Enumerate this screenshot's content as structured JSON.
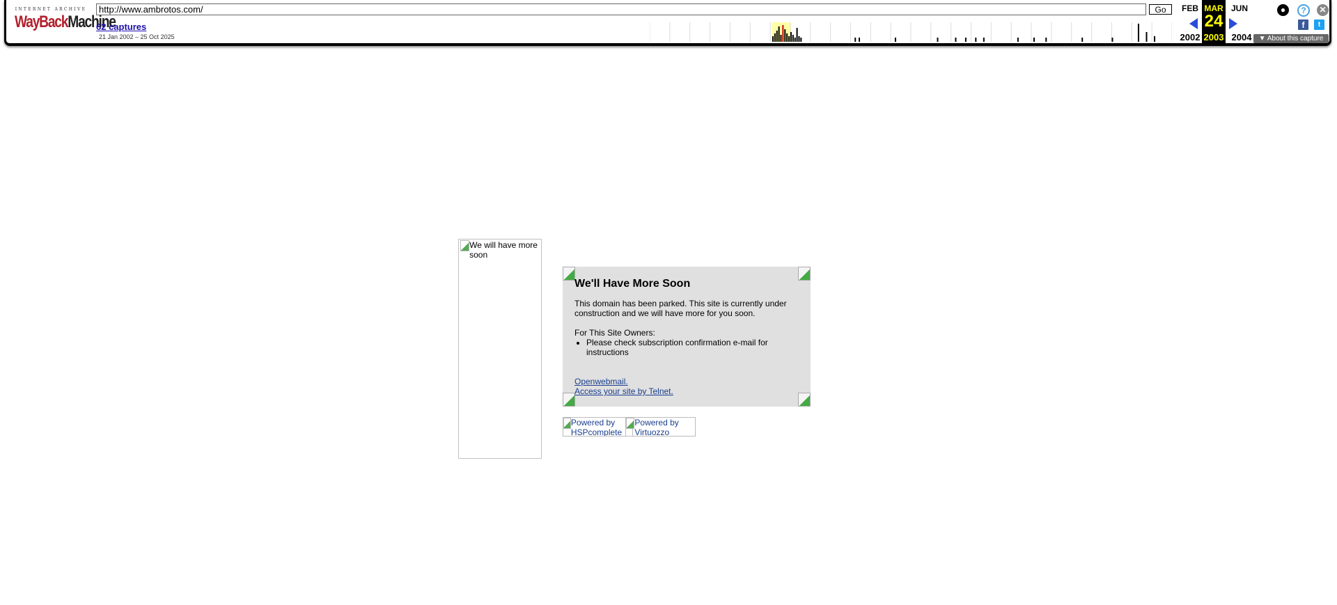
{
  "toolbar": {
    "logo_top": "INTERNET ARCHIVE",
    "logo_wayback": "WayBack",
    "logo_machine": "Machine",
    "url": "http://www.ambrotos.com/",
    "go_label": "Go",
    "captures_label": "62 captures",
    "date_range": "21 Jan 2002 – 25 Oct 2025",
    "prev_month": "FEB",
    "cur_month": "MAR",
    "next_month": "JUN",
    "cur_day": "24",
    "prev_year": "2002",
    "cur_year": "2003",
    "next_year": "2004",
    "about_label": "▼ About this capture",
    "highlight_color": "#ffff00",
    "arrow_color": "#2a4cd8",
    "sparkline_years": 22,
    "sparkline_bars": [
      [
        6.1,
        4
      ],
      [
        6.2,
        6
      ],
      [
        6.3,
        8
      ],
      [
        6.4,
        11
      ],
      [
        6.5,
        5
      ],
      [
        6.6,
        12
      ],
      [
        6.7,
        9
      ],
      [
        6.8,
        6
      ],
      [
        6.9,
        4
      ],
      [
        7.0,
        7
      ],
      [
        7.1,
        5
      ],
      [
        7.2,
        3
      ],
      [
        7.3,
        10
      ],
      [
        7.4,
        4
      ],
      [
        7.5,
        3
      ],
      [
        10.2,
        3
      ],
      [
        10.4,
        3
      ],
      [
        12.2,
        3
      ],
      [
        14.3,
        3
      ],
      [
        15.2,
        3
      ],
      [
        15.7,
        3
      ],
      [
        16.2,
        3
      ],
      [
        16.6,
        3
      ],
      [
        18.3,
        3
      ],
      [
        19.1,
        3
      ],
      [
        19.7,
        3
      ],
      [
        21.5,
        3
      ],
      [
        23.0,
        3
      ],
      [
        24.3,
        13
      ],
      [
        24.7,
        7
      ],
      [
        25.1,
        4
      ]
    ],
    "sparkline_current": 6.6
  },
  "page": {
    "left_image_alt": "We will have more soon",
    "heading": "We'll Have More Soon",
    "para": "This domain has been parked. This site is currently under construction and we will have more for you soon.",
    "owners_label": "For This Site Owners:",
    "owners_item": "Please check subscription confirmation e-mail for instructions",
    "link_webmail": "Openwebmail.",
    "link_telnet": "Access your site by Telnet.",
    "powered_hsp": "Powered by HSPcomplete",
    "powered_virtuozzo": "Powered by Virtuozzo"
  }
}
